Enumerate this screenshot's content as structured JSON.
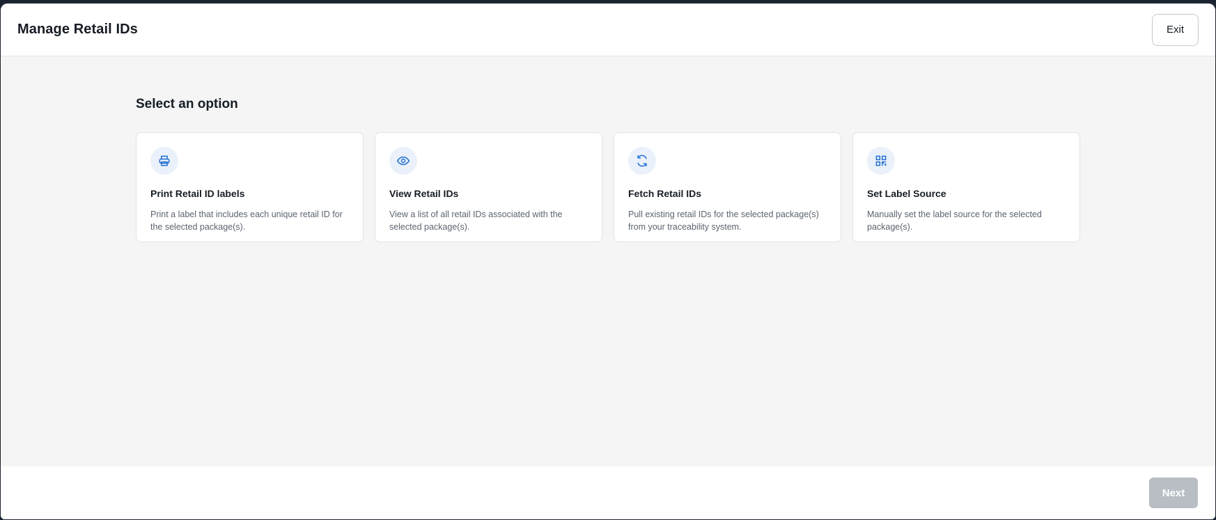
{
  "modal": {
    "title": "Manage Retail IDs",
    "exit_label": "Exit",
    "next_label": "Next"
  },
  "section_title": "Select an option",
  "options": [
    {
      "icon": "printer-icon",
      "title": "Print Retail ID labels",
      "description": "Print a label that includes each unique retail ID for the selected package(s)."
    },
    {
      "icon": "eye-icon",
      "title": "View Retail IDs",
      "description": "View a list of all retail IDs associated with the selected package(s)."
    },
    {
      "icon": "refresh-icon",
      "title": "Fetch Retail IDs",
      "description": "Pull existing retail IDs for the selected package(s) from your traceability system."
    },
    {
      "icon": "qr-code-icon",
      "title": "Set Label Source",
      "description": "Manually set the label source for the selected package(s)."
    }
  ],
  "colors": {
    "accent": "#1f6fd1",
    "icon_bg": "#eaf1fa",
    "disabled_button": "#b8bec4",
    "body_bg": "#f4f5f4"
  }
}
